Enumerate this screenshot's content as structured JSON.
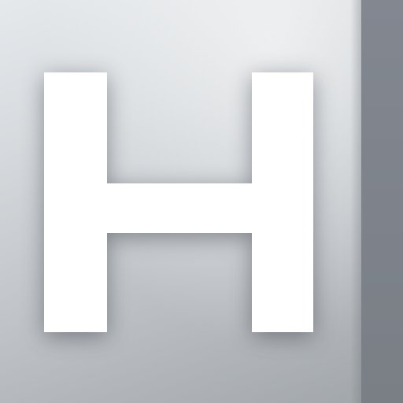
{
  "icon": {
    "letter": "H",
    "colors": {
      "tile_light": "#e6e9ec",
      "tile_dark": "#a2a7ab",
      "side_strip": "#7c8188",
      "glyph": "#ffffff"
    }
  }
}
